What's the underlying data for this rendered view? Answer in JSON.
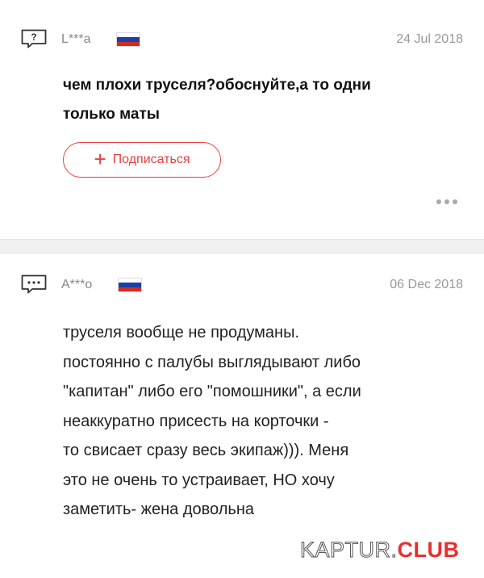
{
  "question": {
    "icon": "question-bubble-icon",
    "icon_glyph": "?",
    "user": "L***a",
    "flag": "russia-flag",
    "date": "24 Jul 2018",
    "text_lines": [
      "чем плохи труселя?обоснуйте,а то одни",
      "только маты"
    ],
    "subscribe_label": "Подписаться",
    "more_icon": "more-dots-icon"
  },
  "answer": {
    "icon": "comment-bubble-icon",
    "user": "A***o",
    "flag": "russia-flag",
    "date": "06 Dec 2018",
    "text_lines": [
      "труселя вообще не продуманы.",
      "постоянно с палубы выглядывают либо",
      "\"капитан\" либо его \"помошники\", а если",
      "неаккуратно присесть на корточки -",
      "то свисает сразу весь экипаж))). Меня",
      "это не очень то устраивает, НО хочу",
      "заметить- жена довольна"
    ]
  },
  "watermark": {
    "part1": "KAPTUR.",
    "part2": "CLUB"
  },
  "colors": {
    "accent": "#e8403e",
    "muted": "#999999"
  }
}
